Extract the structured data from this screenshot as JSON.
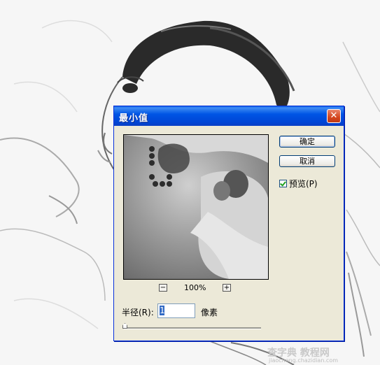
{
  "dialog": {
    "title": "最小值",
    "close_symbol": "✕",
    "ok_label": "确定",
    "cancel_label": "取消",
    "preview_label": "预览(P)",
    "preview_checked": true,
    "zoom": "100%",
    "zoom_minus": "−",
    "zoom_plus": "+",
    "radius_label": "半径(R):",
    "radius_value": "1",
    "radius_unit": "像素"
  },
  "watermark": {
    "text": "查字典 教程网",
    "url": "jiaocheng.chazidian.com"
  },
  "icons": {
    "close": "close-icon",
    "checkbox": "checkmark-icon"
  },
  "colors": {
    "titlebar": "#0055e5",
    "dialog_bg": "#ece9d8",
    "close": "#d4451d"
  }
}
